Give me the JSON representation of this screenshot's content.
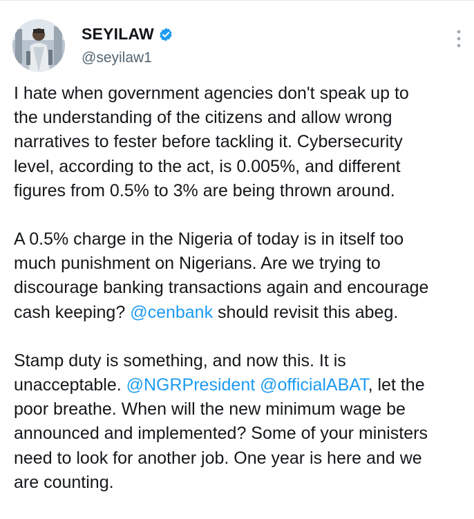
{
  "tweet": {
    "author": {
      "display_name": "SEYILAW",
      "handle": "@seyilaw1",
      "verified": true,
      "verified_color": "#1d9bf0"
    },
    "menu_icon": "more-vertical-icon",
    "paragraphs": [
      {
        "line1": "I hate when government agencies don't speak up to",
        "line2": "the understanding of the citizens and allow wrong",
        "line3": "narratives to fester before tackling it. Cybersecurity",
        "line4": "level, according to the act, is 0.005%, and different",
        "line5": "figures from 0.5% to 3% are being thrown around."
      },
      {
        "line1": "A 0.5% charge in the Nigeria of today is in itself too",
        "line2": "much punishment on Nigerians. Are we trying to",
        "line3": "discourage banking transactions again and encourage",
        "line4_pre": "cash keeping? ",
        "line4_mention": "@cenbank",
        "line4_post": " should revisit this abeg."
      },
      {
        "line1": "Stamp duty is something, and now this. It is",
        "line2_pre": "unacceptable. ",
        "line2_mention1": "@NGRPresident",
        "line2_space": " ",
        "line2_mention2": "@officialABAT",
        "line2_post": ", let the",
        "line3": "poor breathe. When will the new minimum wage be",
        "line4": "announced and implemented? Some of your ministers",
        "line5": "need to look for another job. One year is here and we",
        "line6": "are counting."
      }
    ],
    "colors": {
      "mention": "#1d9bf0",
      "text": "#14171a",
      "handle": "#536471"
    }
  }
}
